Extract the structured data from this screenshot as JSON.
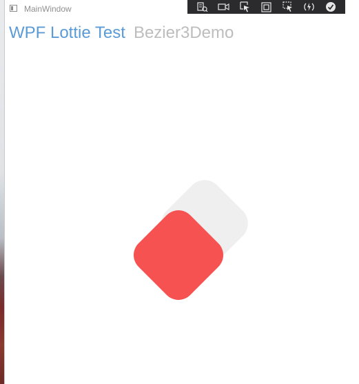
{
  "window": {
    "title": "MainWindow"
  },
  "header": {
    "app_name": "WPF Lottie Test",
    "demo_name": "Bezier3Demo"
  },
  "debug_toolbar": {
    "buttons": [
      {
        "icon": "live-visual-tree-icon"
      },
      {
        "icon": "video-camera-icon"
      },
      {
        "icon": "select-element-icon"
      },
      {
        "icon": "display-layout-adorners-icon"
      },
      {
        "icon": "track-focus-icon"
      },
      {
        "icon": "hot-reload-icon"
      },
      {
        "icon": "check-circle-icon"
      }
    ]
  },
  "colors": {
    "accent_title": "#5b9bd5",
    "subtitle": "#bdbdbd",
    "red_shape": "#f75252",
    "gray_shape": "#efefef",
    "toolbar_bg": "#2b2b2d"
  }
}
